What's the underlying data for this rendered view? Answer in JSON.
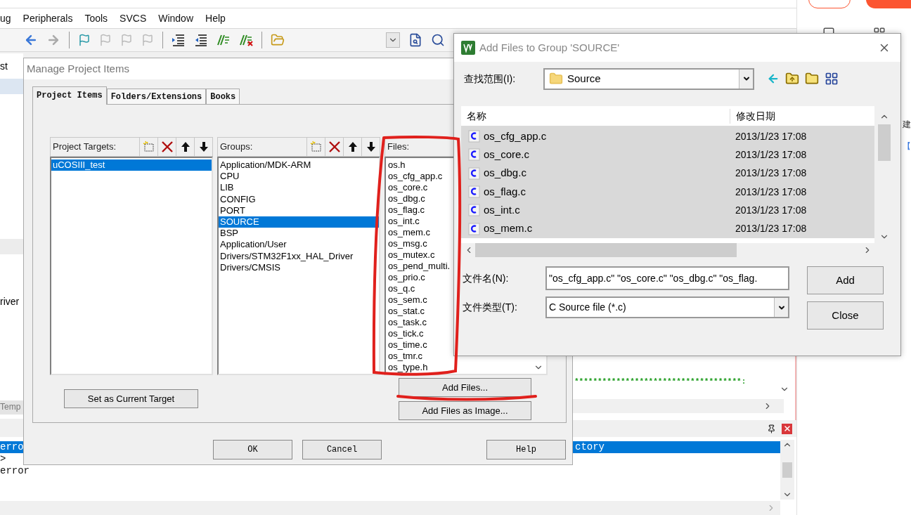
{
  "ide": {
    "menu": [
      "ug",
      "Peripherals",
      "Tools",
      "SVCS",
      "Window",
      "Help"
    ],
    "side_texts": [
      "st",
      "river"
    ],
    "side_tab": "Temp",
    "editor_text": "************************************:",
    "output_rows": [
      {
        "text": "erro",
        "tail": "ctory",
        "selected": true
      },
      {
        "text": ">",
        "tail": "",
        "selected": false
      },
      {
        "text": "error",
        "tail": "",
        "selected": false
      }
    ],
    "right_panel_texts": [
      "建",
      "【"
    ]
  },
  "manage": {
    "title": "Manage Project Items",
    "tabs": [
      {
        "label": "Project Items",
        "selected": true
      },
      {
        "label": "Folders/Extensions",
        "selected": false
      },
      {
        "label": "Books",
        "selected": false
      }
    ],
    "targets": {
      "label": "Project Targets:",
      "items": [
        {
          "text": "uCOSIII_test",
          "selected": true
        }
      ]
    },
    "groups": {
      "label": "Groups:",
      "items": [
        {
          "text": "Application/MDK-ARM",
          "selected": false
        },
        {
          "text": "CPU",
          "selected": false
        },
        {
          "text": "LIB",
          "selected": false
        },
        {
          "text": "CONFIG",
          "selected": false
        },
        {
          "text": "PORT",
          "selected": false
        },
        {
          "text": "SOURCE",
          "selected": true
        },
        {
          "text": "BSP",
          "selected": false
        },
        {
          "text": "Application/User",
          "selected": false
        },
        {
          "text": "Drivers/STM32F1xx_HAL_Driver",
          "selected": false
        },
        {
          "text": "Drivers/CMSIS",
          "selected": false
        }
      ]
    },
    "files": {
      "label": "Files:",
      "items": [
        "os.h",
        "os_cfg_app.c",
        "os_core.c",
        "os_dbg.c",
        "os_flag.c",
        "os_int.c",
        "os_mem.c",
        "os_msg.c",
        "os_mutex.c",
        "os_pend_multi.",
        "os_prio.c",
        "os_q.c",
        "os_sem.c",
        "os_stat.c",
        "os_task.c",
        "os_tick.c",
        "os_time.c",
        "os_tmr.c",
        "os_type.h"
      ]
    },
    "set_target_button": "Set as Current Target",
    "add_files_button": "Add Files...",
    "add_image_button": "Add Files as Image...",
    "buttons": [
      "OK",
      "Cancel",
      "Help"
    ]
  },
  "add_files": {
    "title": "Add Files to Group 'SOURCE'",
    "look_in_label": "查找范围(I):",
    "look_in_value": "Source",
    "columns": [
      "名称",
      "修改日期"
    ],
    "rows": [
      {
        "name": "os_cfg_app.c",
        "date": "2013/1/23 17:08",
        "selected": true
      },
      {
        "name": "os_core.c",
        "date": "2013/1/23 17:08",
        "selected": true
      },
      {
        "name": "os_dbg.c",
        "date": "2013/1/23 17:08",
        "selected": true
      },
      {
        "name": "os_flag.c",
        "date": "2013/1/23 17:08",
        "selected": true
      },
      {
        "name": "os_int.c",
        "date": "2013/1/23 17:08",
        "selected": true
      },
      {
        "name": "os_mem.c",
        "date": "2013/1/23 17:08",
        "selected": true
      }
    ],
    "filename_label": "文件名(N):",
    "filename_value": "\"os_cfg_app.c\" \"os_core.c\" \"os_dbg.c\" \"os_flag.",
    "filetype_label": "文件类型(T):",
    "filetype_value": "C Source file (*.c)",
    "buttons": [
      "Add",
      "Close"
    ]
  }
}
